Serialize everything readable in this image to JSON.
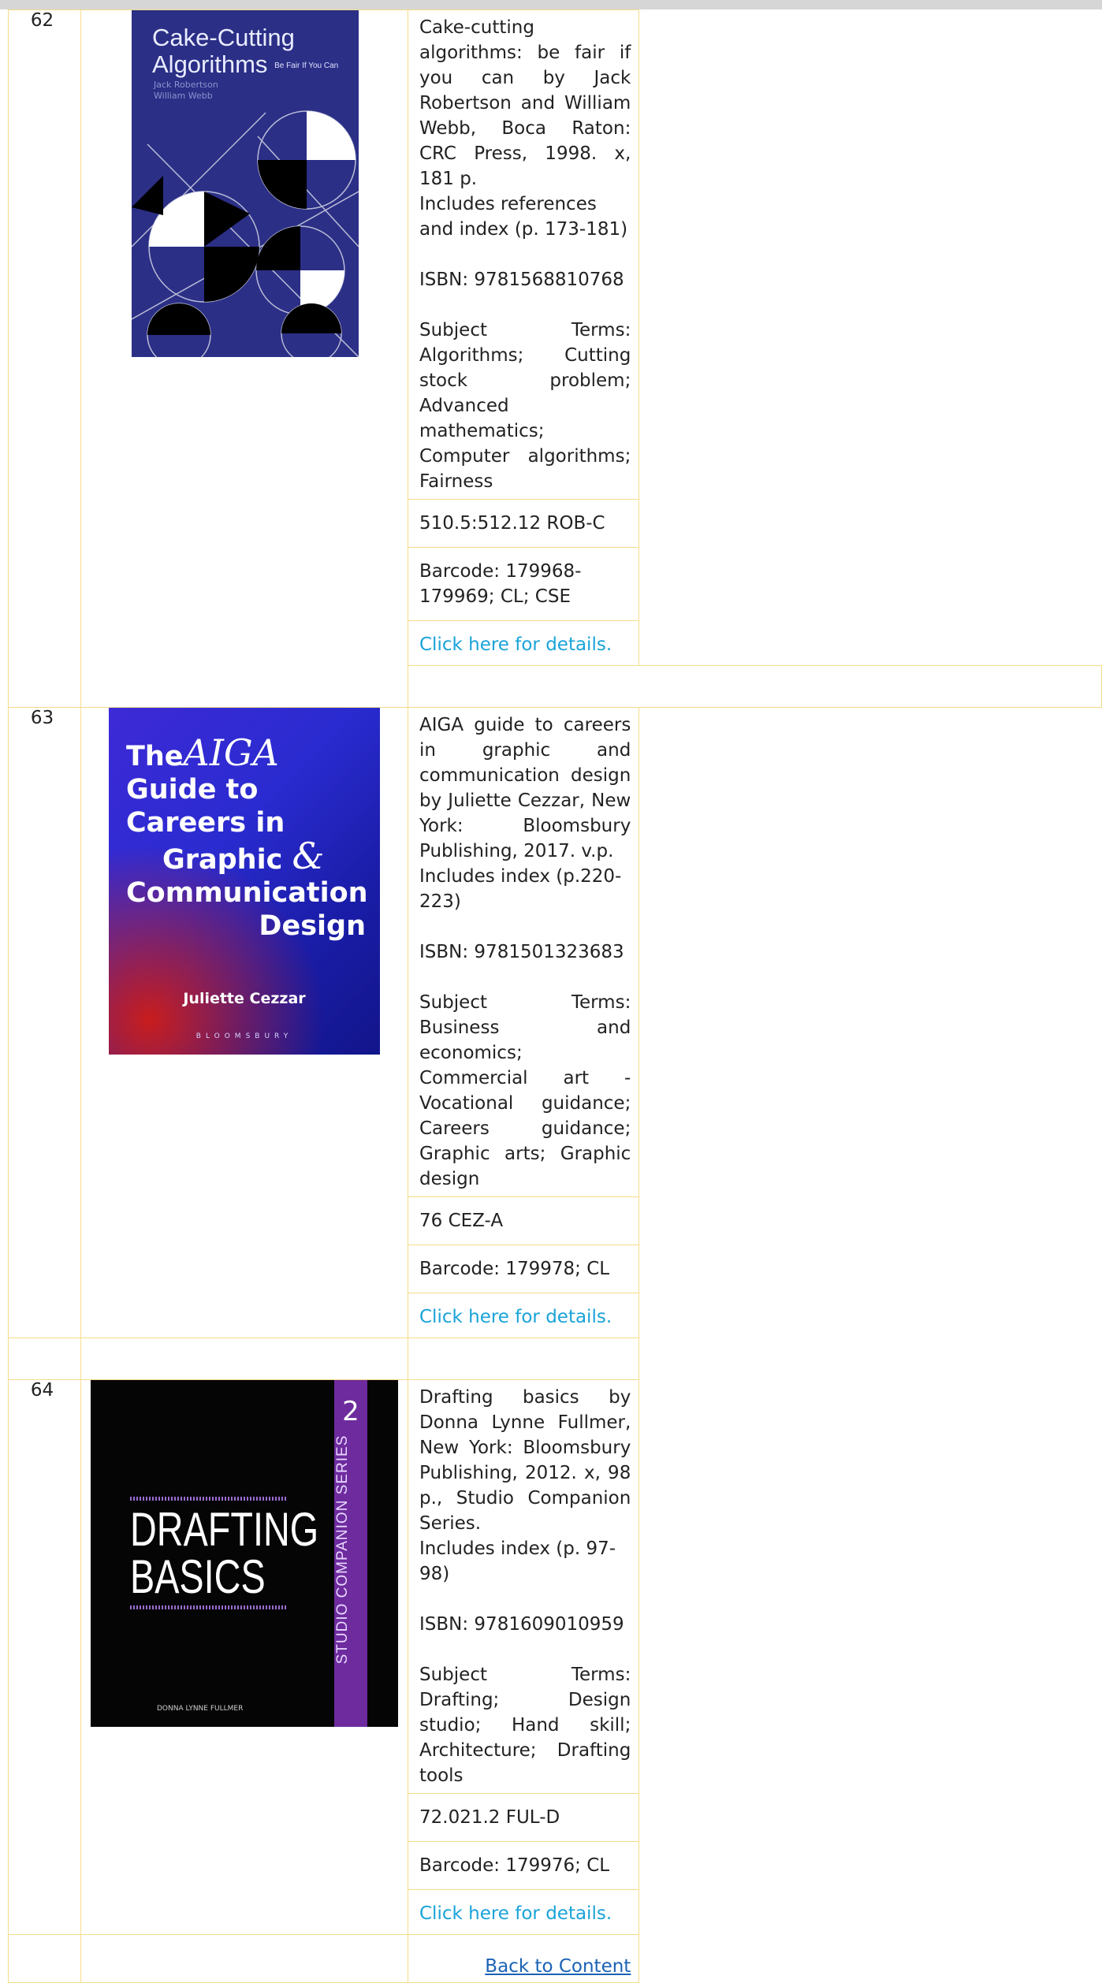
{
  "entries": [
    {
      "number": "62",
      "cover": {
        "title_line1": "Cake-Cutting",
        "title_line2": "Algorithms",
        "title_small": "Be Fair If You Can",
        "author1": "Jack Robertson",
        "author2": "William Webb"
      },
      "description_line1": "Cake-cutting algorithms: be fair if you can by Jack Robertson and William Webb, Boca Raton: CRC Press, 1998. x, 181 p.",
      "description_line2": "Includes references and index (p. 173-181)",
      "isbn": "ISBN: 9781568810768",
      "subjects": "Subject Terms: Algorithms; Cutting stock problem; Advanced mathematics; Computer algorithms; Fairness",
      "call_number": "510.5:512.12 ROB-C",
      "barcode": "Barcode: 179968-179969; CL; CSE",
      "details_link": "Click here for details."
    },
    {
      "number": "63",
      "cover": {
        "the": "The",
        "aiga": "AIGA",
        "line2": "Guide to",
        "line3": "Careers in",
        "line4": "Graphic",
        "amp": "&",
        "line5": "Communication",
        "line6": "Design",
        "author": "Juliette Cezzar",
        "publisher": "BLOOMSBURY"
      },
      "description_line1": "AIGA guide to careers in graphic and communication design by Juliette Cezzar, New York: Bloomsbury Publishing, 2017. v.p.",
      "description_line2": "Includes index (p.220-223)",
      "isbn": "ISBN: 9781501323683",
      "subjects": "Subject Terms: Business and economics; Commercial art - Vocational guidance; Careers guidance; Graphic arts; Graphic design",
      "call_number": "76 CEZ-A",
      "barcode": "Barcode: 179978; CL",
      "details_link": "Click here for details."
    },
    {
      "number": "64",
      "cover": {
        "title_line1": "DRAFTING",
        "title_line2": "BASICS",
        "series": "STUDIO COMPANION SERIES",
        "series_number": "2",
        "author": "DONNA LYNNE FULLMER"
      },
      "description_line1": "Drafting basics by Donna Lynne Fullmer, New York: Bloomsbury Publishing, 2012. x, 98 p., Studio Companion Series.",
      "description_line2": "Includes index (p. 97-98)",
      "isbn": "ISBN: 9781609010959",
      "subjects": "Subject Terms: Drafting; Design studio; Hand skill; Architecture; Drafting tools",
      "call_number": "72.021.2 FUL-D",
      "barcode": "Barcode: 179976; CL",
      "details_link": "Click here for details."
    }
  ],
  "back_link": "Back to Content",
  "colors": {
    "border": "#f5dc89",
    "link": "#1aa3d9",
    "back_link": "#1a62b5"
  }
}
